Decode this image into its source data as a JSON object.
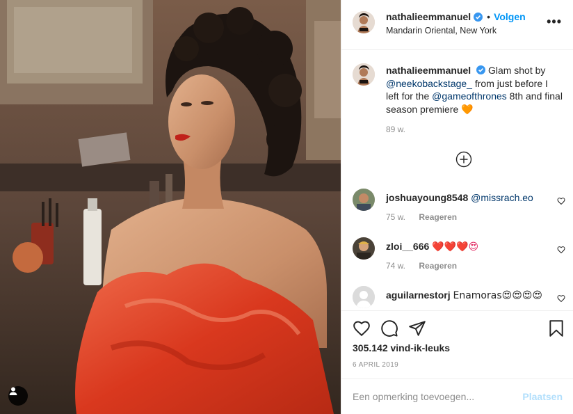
{
  "post": {
    "user_tag_icon": "user-tag-icon"
  },
  "header": {
    "username": "nathalieemmanuel",
    "verified_icon": "verified-badge-icon",
    "separator": "•",
    "follow_label": "Volgen",
    "location": "Mandarin Oriental, New York",
    "more_icon": "more-options-icon",
    "more_label": "•••"
  },
  "caption": {
    "username": "nathalieemmanuel",
    "text_1": "Glam shot by",
    "mention_1": "@neekobackstage_",
    "text_2": "from just before I left for the",
    "mention_2": "@gameofthrones",
    "text_3": "8th and final season premiere",
    "emoji": "🧡",
    "time": "89 w."
  },
  "load_more_icon": "plus-circle-icon",
  "comments": [
    {
      "username": "joshuayoung8548",
      "text": "@missrach.eo",
      "time": "75 w.",
      "reply_label": "Reageren"
    },
    {
      "username": "zloi__666",
      "text": "❤️❤️❤️😍",
      "time": "74 w.",
      "reply_label": "Reageren"
    },
    {
      "username": "aguilarnestorj",
      "text": "Enamoras😍😍😍😍"
    }
  ],
  "actions": {
    "like_icon": "heart-icon",
    "comment_icon": "comment-icon",
    "share_icon": "share-icon",
    "save_icon": "bookmark-icon",
    "likes_count": "305.142 vind-ik-leuks",
    "date": "6 APRIL 2019"
  },
  "add_comment": {
    "placeholder": "Een opmerking toevoegen...",
    "post_label": "Plaatsen"
  },
  "colors": {
    "accent": "#0095f6",
    "post_disabled": "#b2dffc",
    "muted": "#8e8e8e",
    "dress": "#d9381e"
  }
}
